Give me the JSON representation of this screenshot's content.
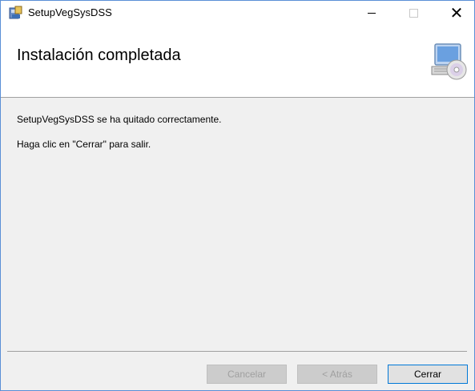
{
  "window": {
    "title": "SetupVegSysDSS",
    "controls": {
      "minimize": "minimize-icon",
      "maximize": "maximize-icon",
      "close": "close-icon"
    }
  },
  "banner": {
    "title": "Instalación completada",
    "icon": "computer-disc-icon"
  },
  "content": {
    "message": "SetupVegSysDSS se ha quitado correctamente.",
    "instruction": "Haga clic en \"Cerrar\" para salir."
  },
  "buttons": {
    "cancel": "Cancelar",
    "back": "< Atrás",
    "close": "Cerrar"
  },
  "colors": {
    "accent": "#0078d7",
    "background": "#f0f0f0"
  }
}
